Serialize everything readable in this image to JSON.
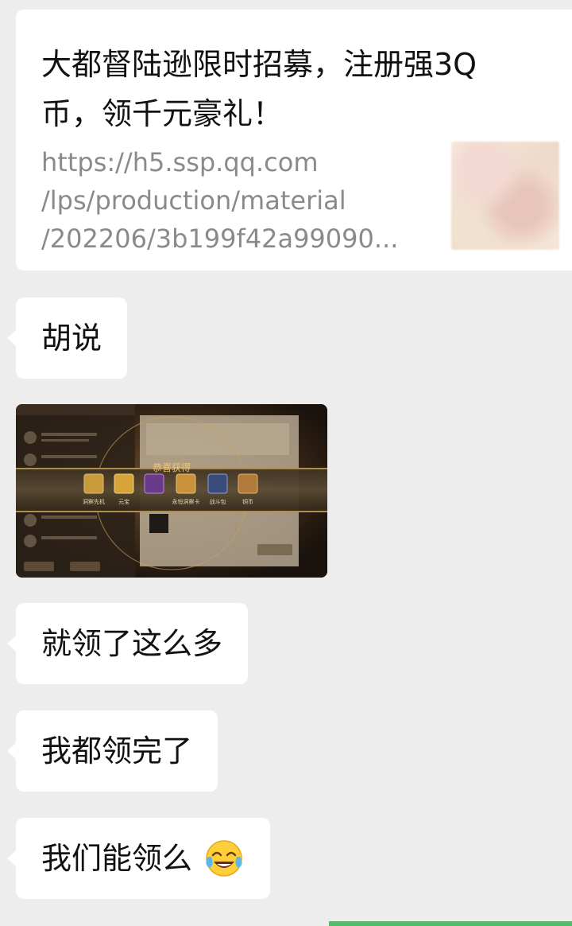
{
  "link_card": {
    "title_line1": "大都督陆逊限时招募，注册强3Q",
    "title_line2": "币，领千元豪礼！",
    "url_line1": "https://h5.ssp.qq.com",
    "url_line2": "/lps/production/material",
    "url_line3": "/202206/3b199f42a99090..."
  },
  "messages": [
    {
      "text": "胡说"
    },
    {
      "text": "就领了这么多"
    },
    {
      "text": "我都领完了"
    },
    {
      "text": "我们能领么"
    }
  ],
  "image_message": {
    "banner_text": "恭喜获得",
    "items": [
      "洞察先机",
      "元宝",
      "",
      "永恒洞察卡",
      "战斗包",
      "铜币"
    ]
  },
  "emoji_icon": "tears-of-joy-emoji"
}
